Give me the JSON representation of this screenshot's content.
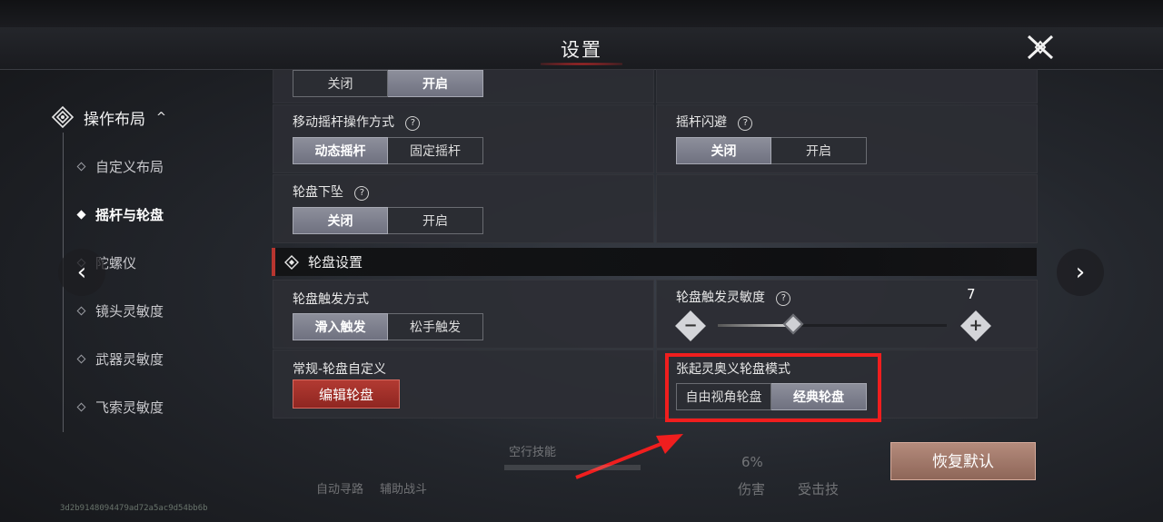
{
  "window": {
    "title": "设置"
  },
  "sidebar": {
    "category": {
      "label": "操作布局",
      "chevron": "^",
      "icon": "diamond-layout-icon"
    },
    "items": [
      {
        "label": "自定义布局",
        "active": false
      },
      {
        "label": "摇杆与轮盘",
        "active": true
      },
      {
        "label": "陀螺仪",
        "active": false
      },
      {
        "label": "镜头灵敏度",
        "active": false
      },
      {
        "label": "武器灵敏度",
        "active": false
      },
      {
        "label": "飞索灵敏度",
        "active": false
      }
    ]
  },
  "nav": {
    "prev": "‹",
    "next": "›"
  },
  "settings": {
    "top_toggle": {
      "off": "关闭",
      "on": "开启",
      "selected": "on"
    },
    "joystick_mode": {
      "label": "移动摇杆操作方式",
      "help": "?",
      "options": [
        "动态摇杆",
        "固定摇杆"
      ],
      "selected": 0
    },
    "joystick_dodge": {
      "label": "摇杆闪避",
      "help": "?",
      "options": [
        "关闭",
        "开启"
      ],
      "selected": 0
    },
    "wheel_drop": {
      "label": "轮盘下坠",
      "help": "?",
      "options": [
        "关闭",
        "开启"
      ],
      "selected": 0
    }
  },
  "wheel_section": {
    "title": "轮盘设置",
    "trigger_mode": {
      "label": "轮盘触发方式",
      "options": [
        "滑入触发",
        "松手触发"
      ],
      "selected": 0
    },
    "sensitivity": {
      "label": "轮盘触发灵敏度",
      "help": "?",
      "value": "7",
      "fraction": 0.33,
      "minus": "−",
      "plus": "+"
    },
    "custom": {
      "label": "常规-轮盘自定义",
      "button": "编辑轮盘"
    },
    "ultimate_mode": {
      "label": "张起灵奥义轮盘模式",
      "options": [
        "自由视角轮盘",
        "经典轮盘"
      ],
      "selected": 1
    }
  },
  "restore_button": "恢复默认",
  "hud": {
    "skill_bar": "空行技能",
    "auto_path": "自动寻路",
    "assist_fight": "辅助战斗",
    "damage_pct": "6%",
    "damage": "伤害",
    "hit_skill": "受击技"
  },
  "status": {
    "text": "3d2b9148094479ad72a5ac9d54bb6b"
  },
  "colors": {
    "accent_red": "#b7352f",
    "highlight": "#f01e1e",
    "selected_seg": "#7f8190"
  }
}
